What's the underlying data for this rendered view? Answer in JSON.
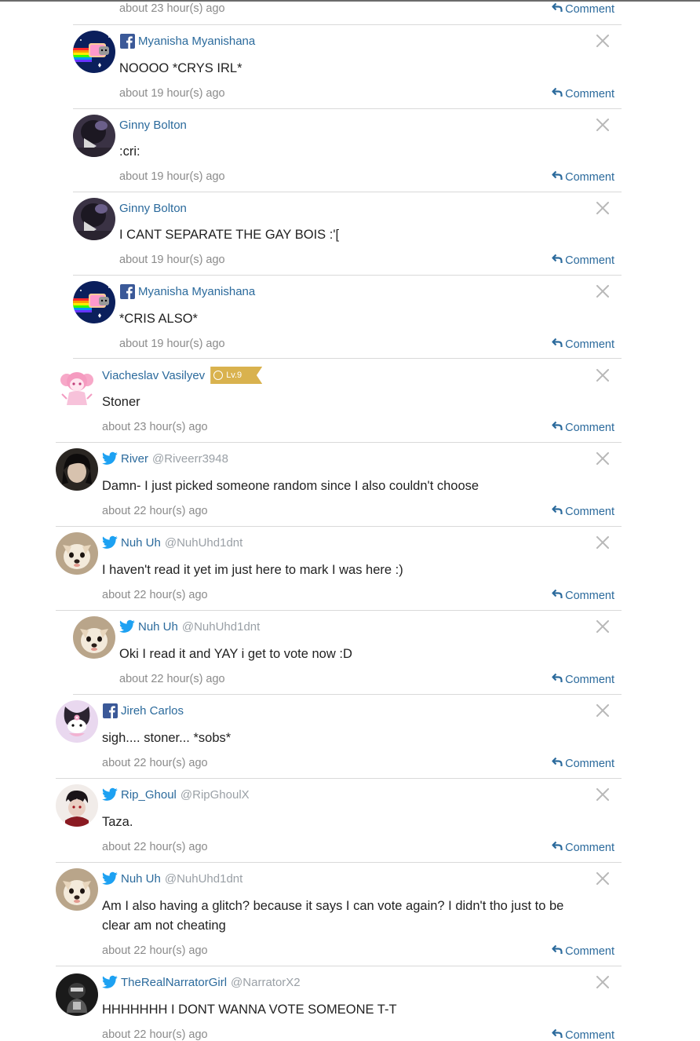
{
  "colors": {
    "link": "#2b6a9c",
    "meta": "#8b8b8b",
    "divider": "#d9d9d9",
    "level_badge": "#d9b24e",
    "facebook": "#3b5998",
    "twitter": "#1da1f2"
  },
  "comment_label": "Comment",
  "comments": [
    {
      "avatar": "avatar-partial",
      "network": "none",
      "name": "",
      "handle": "",
      "text": "",
      "time": "about 23 hour(s) ago",
      "reply": true
    },
    {
      "avatar": "nyan-cat",
      "network": "facebook",
      "name": "Myanisha Myanishana",
      "handle": "",
      "text": "NOOOO *CRYS IRL*",
      "time": "about 19 hour(s) ago",
      "reply": true
    },
    {
      "avatar": "dark-figure",
      "network": "none",
      "name": "Ginny Bolton",
      "handle": "",
      "text": ":cri:",
      "time": "about 19 hour(s) ago",
      "reply": true
    },
    {
      "avatar": "dark-figure",
      "network": "none",
      "name": "Ginny Bolton",
      "handle": "",
      "text": "I CANT SEPARATE THE GAY BOIS :'[",
      "time": "about 19 hour(s) ago",
      "reply": true
    },
    {
      "avatar": "nyan-cat",
      "network": "facebook",
      "name": "Myanisha Myanishana",
      "handle": "",
      "text": "*CRIS ALSO*",
      "time": "about 19 hour(s) ago",
      "reply": true
    },
    {
      "avatar": "pink-anime",
      "network": "none",
      "name": "Viacheslav Vasilyev",
      "handle": "",
      "level": "Lv.9",
      "text": "Stoner",
      "time": "about 23 hour(s) ago",
      "reply": false
    },
    {
      "avatar": "dark-hair",
      "network": "twitter",
      "name": "River",
      "handle": "@Riveerr3948",
      "text": "Damn- I just picked someone random since I also couldn't choose",
      "time": "about 22 hour(s) ago",
      "reply": false
    },
    {
      "avatar": "chihuahua",
      "network": "twitter",
      "name": "Nuh Uh",
      "handle": "@NuhUhd1dnt",
      "text": "I haven't read it yet im just here to mark I was here :)",
      "time": "about 22 hour(s) ago",
      "reply": false
    },
    {
      "avatar": "chihuahua",
      "network": "twitter",
      "name": "Nuh Uh",
      "handle": "@NuhUhd1dnt",
      "text": "Oki I read it and YAY i get to vote now :D",
      "time": "about 22 hour(s) ago",
      "reply": true
    },
    {
      "avatar": "kuromi",
      "network": "facebook",
      "name": "Jireh Carlos",
      "handle": "",
      "text": "sigh.... stoner... *sobs*",
      "time": "about 22 hour(s) ago",
      "reply": false
    },
    {
      "avatar": "red-anime",
      "network": "twitter",
      "name": "Rip_Ghoul",
      "handle": "@RipGhoulX",
      "text": "Taza.",
      "time": "about 22 hour(s) ago",
      "reply": false
    },
    {
      "avatar": "chihuahua",
      "network": "twitter",
      "name": "Nuh Uh",
      "handle": "@NuhUhd1dnt",
      "text": "Am I also having a glitch? because it says I can vote again? I didn't tho just to be clear am not cheating",
      "time": "about 22 hour(s) ago",
      "reply": false
    },
    {
      "avatar": "gray-figure",
      "network": "twitter",
      "name": "TheRealNarratorGirl",
      "handle": "@NarratorX2",
      "text": "HHHHHHH I DONT WANNA VOTE SOMEONE T-T",
      "time": "about 22 hour(s) ago",
      "reply": false
    }
  ]
}
